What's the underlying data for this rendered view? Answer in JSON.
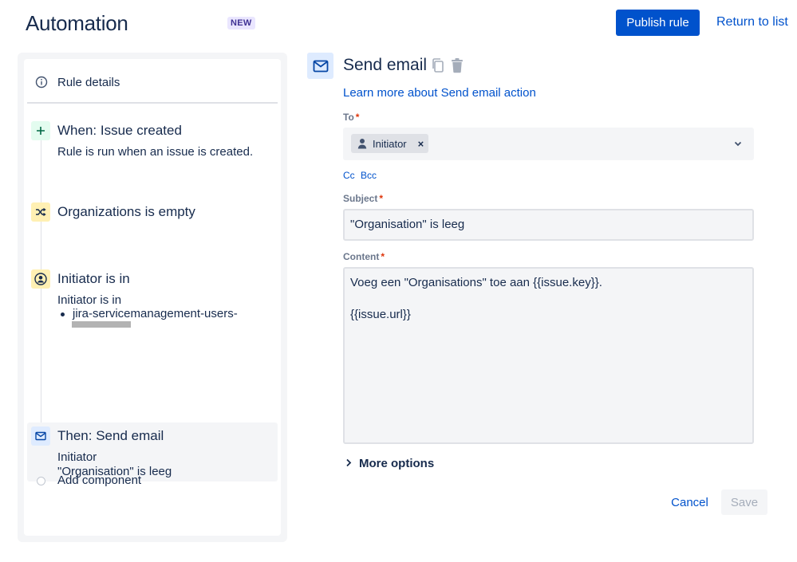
{
  "header": {
    "title": "Automation",
    "badge": "NEW",
    "publish_label": "Publish rule",
    "return_label": "Return to list"
  },
  "sidebar": {
    "rule_details_label": "Rule details",
    "steps": [
      {
        "title": "When: Issue created",
        "desc": "Rule is run when an issue is created.",
        "icon": "plus-icon"
      },
      {
        "title": "Organizations is empty",
        "icon": "shuffle-icon"
      },
      {
        "title": "Initiator is in",
        "desc": "Initiator is in",
        "bullet": "jira-servicemanagement-users-",
        "icon": "user-circle-icon"
      },
      {
        "title": "Then: Send email",
        "desc_line1": "Initiator",
        "desc_line2": "\"Organisation\" is leeg",
        "icon": "mail-icon"
      }
    ],
    "add_component_label": "Add component"
  },
  "action": {
    "title": "Send email",
    "learn_more": "Learn more about Send email action",
    "to_label": "To",
    "to_chip": "Initiator",
    "cc_label": "Cc",
    "bcc_label": "Bcc",
    "subject_label": "Subject",
    "subject_value": "\"Organisation\" is leeg",
    "content_label": "Content",
    "content_value": "Voeg een \"Organisations\" toe aan {{issue.key}}.\n\n{{issue.url}}",
    "more_options": "More options",
    "cancel_label": "Cancel",
    "save_label": "Save"
  },
  "colors": {
    "primary": "#0052cc",
    "text": "#172b4d",
    "required": "#de350b",
    "badge_bg": "#eae6ff"
  }
}
